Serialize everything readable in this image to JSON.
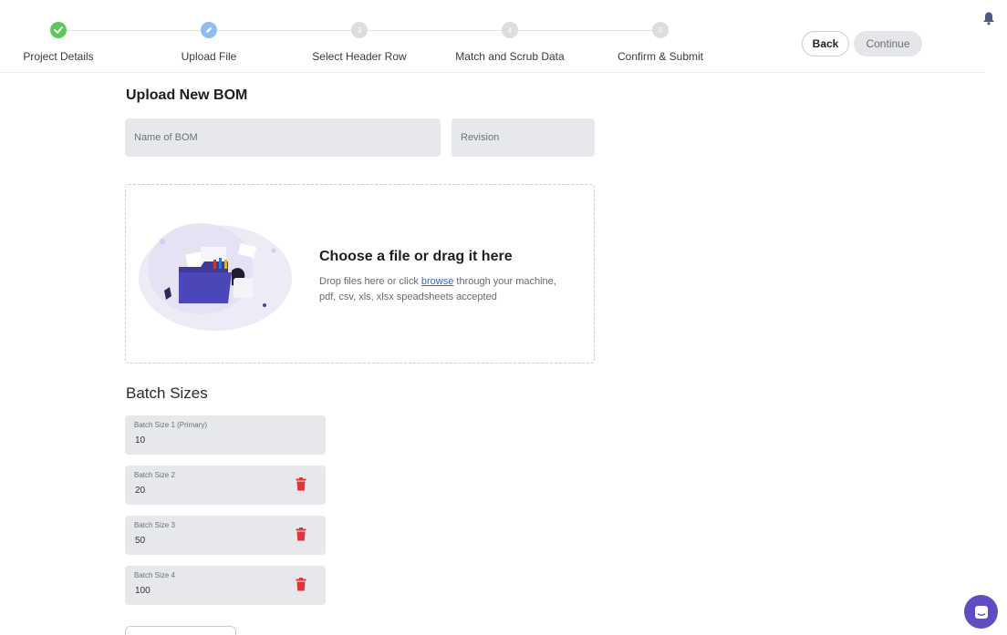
{
  "stepper": {
    "steps": [
      {
        "label": "Project Details",
        "state": "done"
      },
      {
        "label": "Upload File",
        "state": "current"
      },
      {
        "label": "Select Header Row",
        "state": "todo",
        "number": "3"
      },
      {
        "label": "Match and Scrub Data",
        "state": "todo",
        "number": "4"
      },
      {
        "label": "Confirm & Submit",
        "state": "todo",
        "number": "5"
      }
    ]
  },
  "actions": {
    "back_label": "Back",
    "continue_label": "Continue"
  },
  "upload": {
    "title": "Upload New BOM",
    "name_placeholder": "Name of BOM",
    "revision_placeholder": "Revision"
  },
  "dropzone": {
    "title": "Choose a file or drag it here",
    "line1_before": "Drop files here or click ",
    "link": "browse",
    "line1_after": " through your machine,",
    "line2": "pdf, csv, xls, xlsx speadsheets accepted"
  },
  "batch": {
    "title": "Batch Sizes",
    "items": [
      {
        "label": "Batch Size 1 (Primary)",
        "value": "10"
      },
      {
        "label": "Batch Size 2",
        "value": "20"
      },
      {
        "label": "Batch Size 3",
        "value": "50"
      },
      {
        "label": "Batch Size 4",
        "value": "100"
      }
    ]
  },
  "colors": {
    "done": "#5bc85b",
    "current": "#8fbdf0",
    "delete": "#e0353b",
    "chat": "#5f4ec3"
  },
  "icons": [
    "check-icon",
    "bell-icon",
    "trash-icon",
    "chat-icon",
    "folder-illustration"
  ]
}
